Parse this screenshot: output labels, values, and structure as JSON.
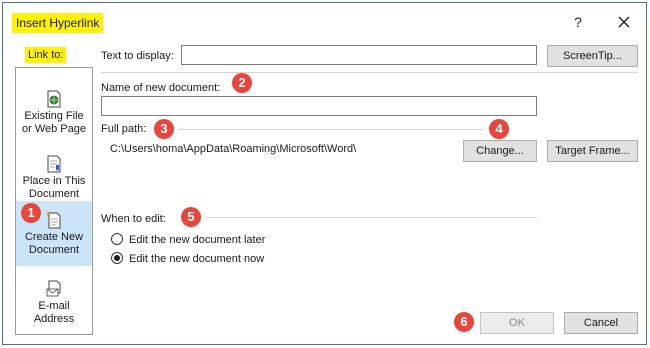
{
  "window": {
    "title": "Insert Hyperlink",
    "help_glyph": "?",
    "close_icon": "close-icon"
  },
  "link_to": {
    "label": "Link to:",
    "items": [
      {
        "label": "Existing File\nor Web Page",
        "icon": "globe-file-icon",
        "selected": false
      },
      {
        "label": "Place in This\nDocument",
        "icon": "document-bookmark-icon",
        "selected": false
      },
      {
        "label": "Create New\nDocument",
        "icon": "new-document-icon",
        "selected": true
      },
      {
        "label": "E-mail\nAddress",
        "icon": "envelope-icon",
        "selected": false
      }
    ]
  },
  "form": {
    "text_to_display_label": "Text to display:",
    "text_to_display_value": "",
    "screentip_label": "ScreenTip...",
    "new_doc_label": "Name of new document:",
    "new_doc_value": "",
    "full_path_label": "Full path:",
    "full_path_value": "C:\\Users\\homa\\AppData\\Roaming\\Microsoft\\Word\\",
    "change_label": "Change...",
    "target_frame_label": "Target Frame...",
    "when_to_edit_label": "When to edit:",
    "options": [
      {
        "label": "Edit the new document later",
        "selected": false
      },
      {
        "label": "Edit the new document now",
        "selected": true
      }
    ]
  },
  "buttons": {
    "ok_label": "OK",
    "ok_enabled": false,
    "cancel_label": "Cancel"
  },
  "annotations": [
    "1",
    "2",
    "3",
    "4",
    "5",
    "6"
  ],
  "colors": {
    "highlight": "#fff200",
    "badge": "#e8453c",
    "selected_item": "#cce4f7",
    "frame": "#4a6fa5"
  }
}
